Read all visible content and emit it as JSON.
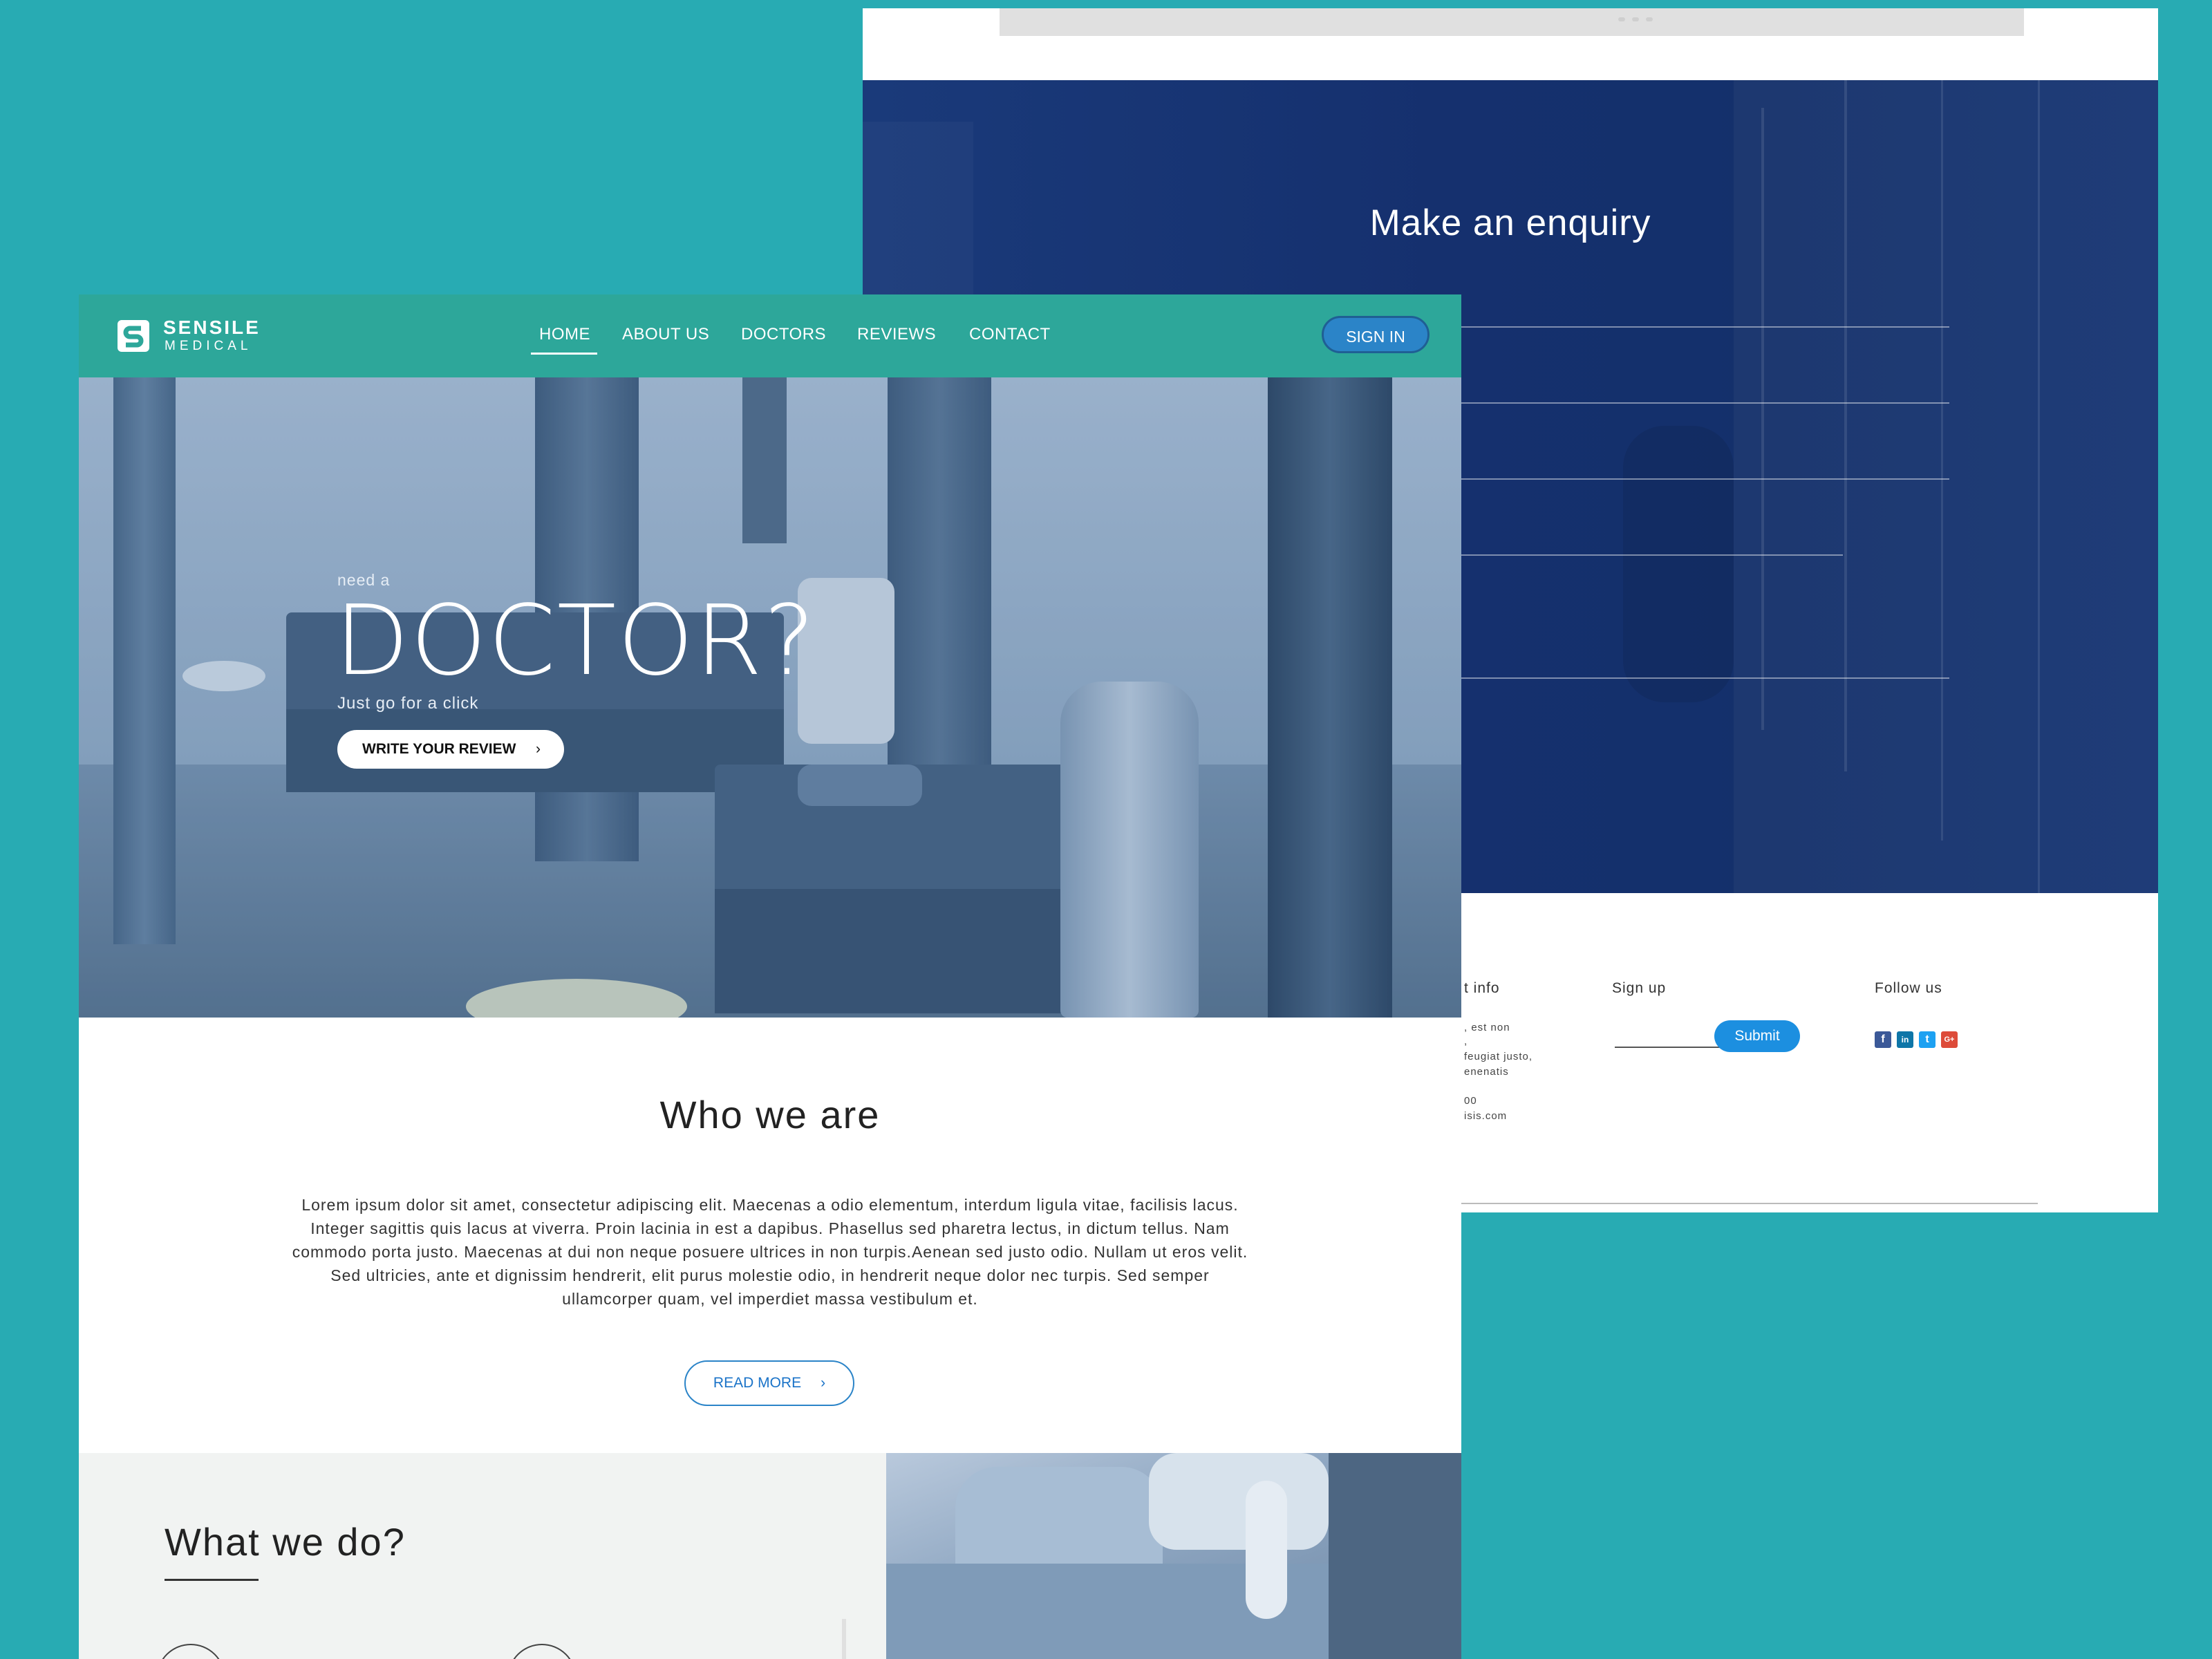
{
  "back_page": {
    "enquiry_title": "Make an enquiry",
    "footer": {
      "contact_heading": "t info",
      "contact_lines": [
        ", est non",
        ",",
        " feugiat justo,",
        "enenatis",
        "",
        "00",
        "isis.com"
      ],
      "signup_heading": "Sign up",
      "submit_label": "Submit",
      "follow_heading": "Follow us",
      "social_icons": [
        "facebook-icon",
        "linkedin-icon",
        "twitter-icon",
        "google-plus-icon"
      ],
      "social_glyphs": [
        "f",
        "in",
        "t",
        "G+"
      ]
    }
  },
  "front_page": {
    "brand": {
      "name": "SENSILE",
      "sub": "MEDICAL"
    },
    "nav": {
      "items": [
        "HOME",
        "ABOUT US",
        "DOCTORS",
        "REVIEWS",
        "CONTACT"
      ],
      "active": "HOME",
      "signin_label": "SIGN IN"
    },
    "hero": {
      "kicker": "need a",
      "headline": "DOCTOR?",
      "subline": "Just go for a click",
      "cta_label": "WRITE YOUR REVIEW",
      "cta_chevron": "›"
    },
    "who": {
      "title": "Who we are",
      "body": "Lorem ipsum dolor sit amet, consectetur adipiscing elit. Maecenas a odio elementum, interdum ligula vitae, facilisis lacus. Integer sagittis quis lacus at viverra. Proin lacinia in est a dapibus. Phasellus sed pharetra lectus, in dictum tellus. Nam commodo porta justo. Maecenas at dui non neque posuere ultrices in non turpis.Aenean sed justo odio. Nullam ut eros velit. Sed ultricies, ante et dignissim hendrerit, elit purus molestie odio, in hendrerit neque dolor nec turpis. Sed semper ullamcorper quam, vel imperdiet massa vestibulum et.",
      "readmore_label": "READ MORE",
      "readmore_chevron": "›"
    },
    "what": {
      "title": "What we do?"
    }
  },
  "colors": {
    "background": "#28abb3",
    "nav": "#2da79a",
    "enquiry": "#15306e",
    "accent_blue": "#2b84c8"
  }
}
